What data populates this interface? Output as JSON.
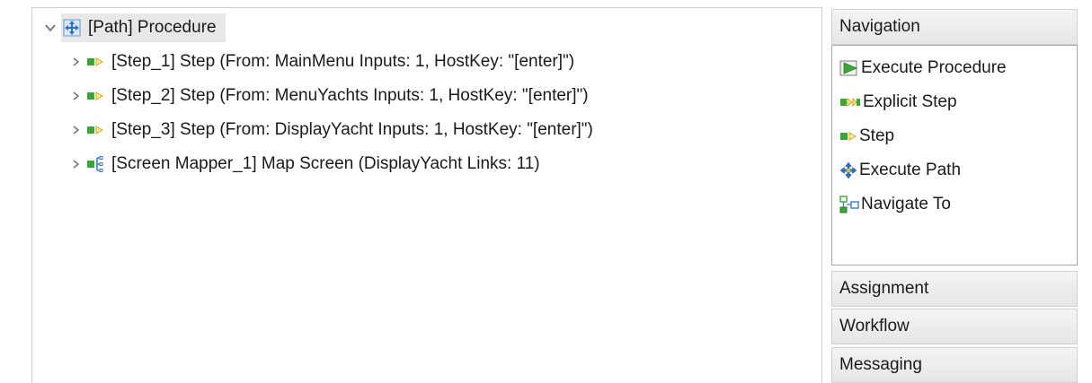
{
  "tree": {
    "root": {
      "label": "[Path] Procedure",
      "icon": "execute-path-icon"
    },
    "children": [
      {
        "label": "[Step_1] Step (From: MainMenu Inputs: 1, HostKey: \"[enter]\")",
        "icon": "step-icon"
      },
      {
        "label": "[Step_2] Step (From: MenuYachts Inputs: 1, HostKey: \"[enter]\")",
        "icon": "step-icon"
      },
      {
        "label": "[Step_3] Step (From: DisplayYacht Inputs: 1, HostKey: \"[enter]\")",
        "icon": "step-icon"
      },
      {
        "label": "[Screen Mapper_1] Map Screen (DisplayYacht Links: 11)",
        "icon": "screen-mapper-icon"
      }
    ]
  },
  "palette": {
    "drawers": [
      {
        "label": "Navigation",
        "expanded": true
      },
      {
        "label": "Assignment"
      },
      {
        "label": "Workflow"
      },
      {
        "label": "Messaging"
      }
    ],
    "navigation_tools": [
      {
        "label": "Execute Procedure",
        "icon": "execute-procedure-icon"
      },
      {
        "label": "Explicit Step",
        "icon": "explicit-step-icon"
      },
      {
        "label": "Step",
        "icon": "step-icon"
      },
      {
        "label": "Execute Path",
        "icon": "execute-path-icon"
      },
      {
        "label": "Navigate To",
        "icon": "navigate-to-icon"
      }
    ]
  },
  "colors": {
    "step_green": "#3aa63a",
    "step_yellow": "#e8c21a",
    "path_blue": "#2a6fc9",
    "drawer_border": "#d2d2d2"
  }
}
